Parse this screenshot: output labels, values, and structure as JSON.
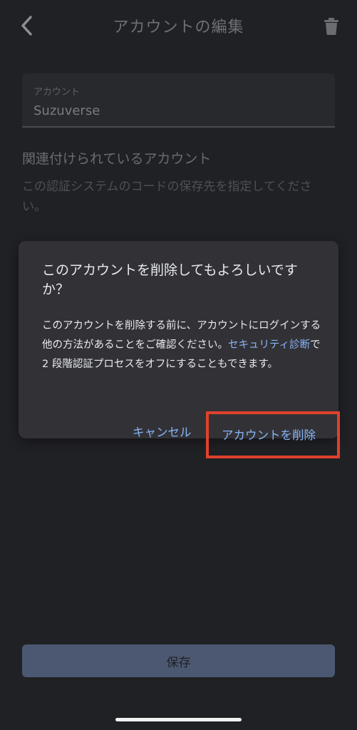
{
  "header": {
    "title": "アカウントの編集"
  },
  "account_field": {
    "label": "アカウント",
    "value": "Suzuverse"
  },
  "linked_section": {
    "heading": "関連付けられているアカウント",
    "description": "この認証システムのコードの保存先を指定してください。"
  },
  "dialog": {
    "title": "このアカウントを削除してもよろしいですか？",
    "body_before": "このアカウントを削除する前に、アカウントにログインする他の方法があることをご確認ください。",
    "link": "セキュリティ診断",
    "body_after": "で 2 段階認証プロセスをオフにすることもできます。",
    "cancel_label": "キャンセル",
    "delete_label": "アカウントを削除"
  },
  "save_label": "保存",
  "colors": {
    "background": "#202125",
    "dialog": "#323236",
    "accent": "#8ab4f8",
    "highlight": "#e0412b"
  }
}
